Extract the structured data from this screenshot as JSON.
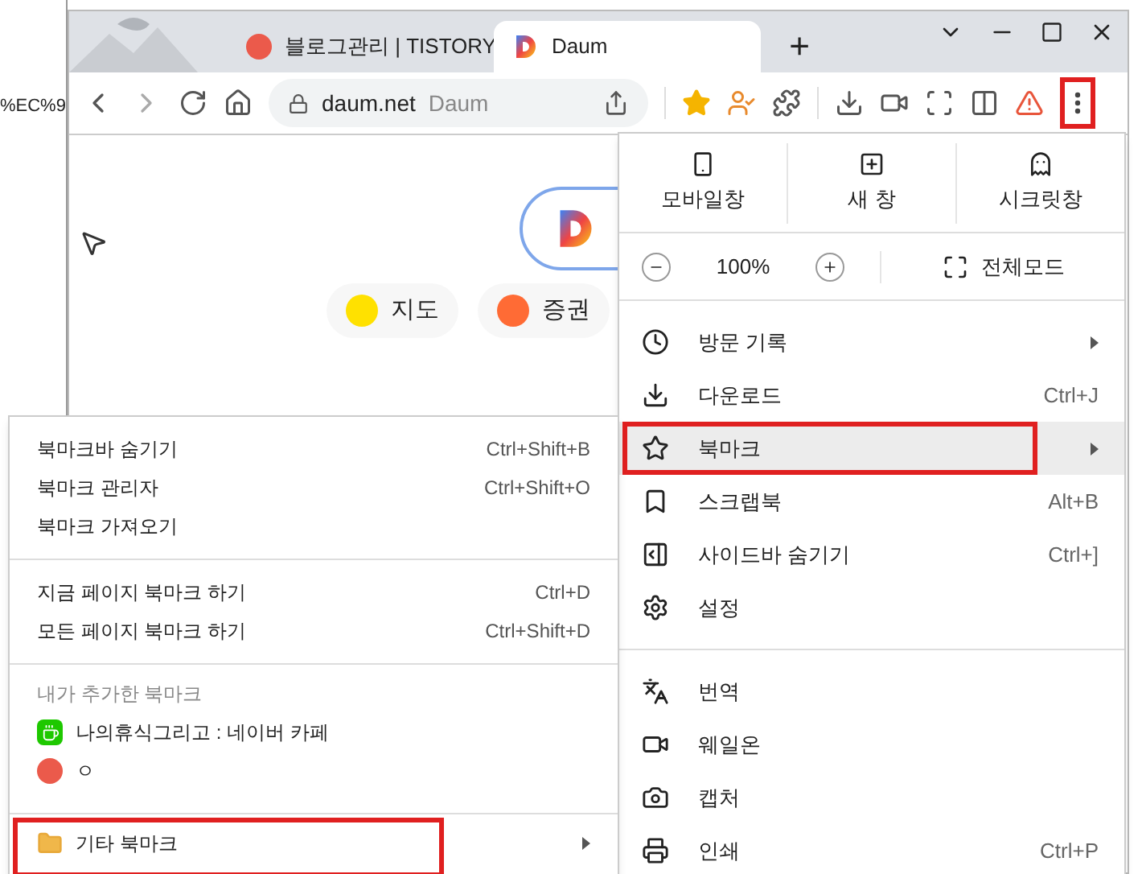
{
  "background_page": {
    "text": "%EC%9"
  },
  "tabs": [
    {
      "title": "블로그관리 | TISTORY",
      "selected": false,
      "kind": "tistory"
    },
    {
      "title": "Daum",
      "selected": true,
      "kind": "daum"
    }
  ],
  "new_tab": "+",
  "address_bar": {
    "url": "daum.net",
    "site": "Daum"
  },
  "toolbar": {
    "more_annotated": true
  },
  "page": {
    "shortcuts": [
      "지도",
      "증권"
    ]
  },
  "main_menu": {
    "top_buttons": [
      "모바일창",
      "새 창",
      "시크릿창"
    ],
    "zoom": "100%",
    "fullscreen": "전체모드",
    "groups": [
      [
        {
          "label": "방문 기록",
          "submenu": true,
          "selected": false,
          "annotated": false
        },
        {
          "label": "다운로드",
          "shortcut": "Ctrl+J",
          "submenu": false,
          "selected": false,
          "annotated": false
        },
        {
          "label": "북마크",
          "submenu": true,
          "selected": true,
          "annotated": true
        },
        {
          "label": "스크랩북",
          "shortcut": "Alt+B",
          "submenu": false,
          "selected": false,
          "annotated": false
        },
        {
          "label": "사이드바 숨기기",
          "shortcut": "Ctrl+]",
          "submenu": false,
          "selected": false,
          "annotated": false
        },
        {
          "label": "설정",
          "submenu": false,
          "selected": false,
          "annotated": false
        }
      ],
      [
        {
          "label": "번역",
          "submenu": false,
          "selected": false,
          "annotated": false
        },
        {
          "label": "웨일온",
          "submenu": false,
          "selected": false,
          "annotated": false
        },
        {
          "label": "캡처",
          "submenu": false,
          "selected": false,
          "annotated": false
        },
        {
          "label": "인쇄",
          "shortcut": "Ctrl+P",
          "submenu": false,
          "selected": false,
          "annotated": false
        }
      ]
    ]
  },
  "bookmark_menu": {
    "groups": [
      [
        {
          "label": "북마크바 숨기기",
          "shortcut": "Ctrl+Shift+B"
        },
        {
          "label": "북마크 관리자",
          "shortcut": "Ctrl+Shift+O"
        },
        {
          "label": "북마크 가져오기"
        }
      ],
      [
        {
          "label": "지금 페이지 북마크 하기",
          "shortcut": "Ctrl+D"
        },
        {
          "label": "모든 페이지 북마크 하기",
          "shortcut": "Ctrl+Shift+D"
        }
      ]
    ],
    "section_title": "내가 추가한 북마크",
    "bookmarks": [
      {
        "title": "나의휴식그리고 : 네이버 카페",
        "kind": "cafe"
      },
      {
        "title": "ㅇ",
        "kind": "tistory"
      }
    ],
    "folder": {
      "label": "기타 북마크",
      "selected": false,
      "annotated": true
    }
  }
}
